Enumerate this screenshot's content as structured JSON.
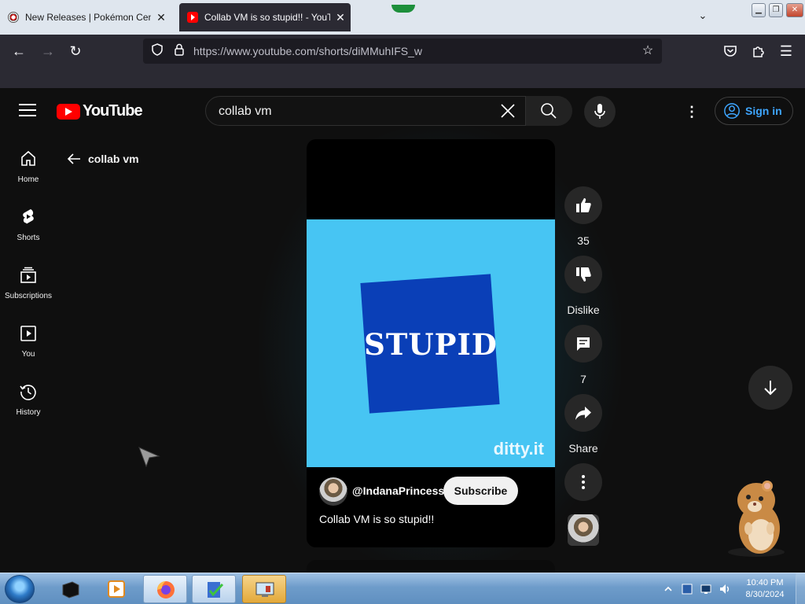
{
  "browser": {
    "tabs": [
      {
        "title": "New Releases | Pokémon Cente",
        "active": false
      },
      {
        "title": "Collab VM is so stupid!! - YouTu",
        "active": true
      }
    ],
    "url": "https://www.youtube.com/shorts/diMMuhIFS_w"
  },
  "youtube": {
    "logo_text": "YouTube",
    "search": {
      "value": "collab vm"
    },
    "signin_label": "Sign in",
    "sidebar": [
      {
        "label": "Home"
      },
      {
        "label": "Shorts"
      },
      {
        "label": "Subscriptions"
      },
      {
        "label": "You"
      },
      {
        "label": "History"
      }
    ],
    "back_label": "collab vm",
    "short": {
      "video_text": "STUPID",
      "watermark": "ditty.it",
      "channel": "@IndanaPrincess",
      "subscribe_label": "Subscribe",
      "title": "Collab VM is so stupid!!"
    },
    "actions": {
      "likes": "35",
      "dislike_label": "Dislike",
      "comments": "7",
      "share_label": "Share"
    }
  },
  "taskbar": {
    "time": "10:40 PM",
    "date": "8/30/2024"
  },
  "colors": {
    "youtube_bg": "#0f0f0f",
    "video_bg": "#47c5f3",
    "square_blue": "#0a3fb7",
    "accent_blue": "#3ea6ff",
    "browser_chrome": "#2b2a33"
  }
}
